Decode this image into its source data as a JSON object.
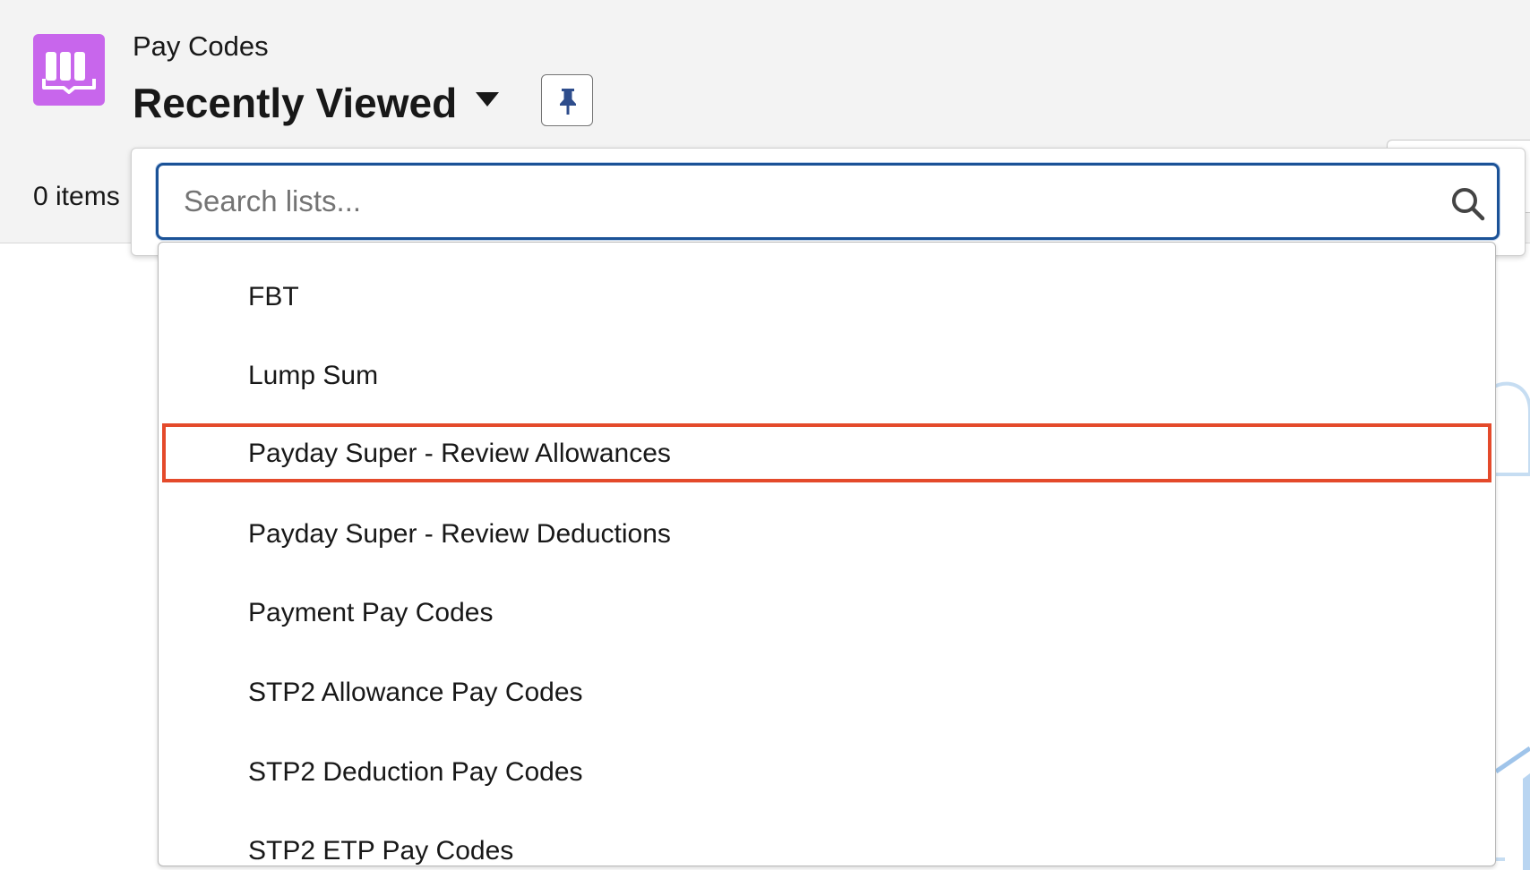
{
  "header": {
    "object_name": "Pay Codes",
    "list_view_title": "Recently Viewed",
    "items_count": "0 items",
    "app_icon": "book-icon",
    "caret_icon": "caret-down-icon",
    "pin_icon": "pin-icon"
  },
  "list_picker": {
    "search": {
      "placeholder": "Search lists...",
      "value": "",
      "icon": "search-icon"
    },
    "highlighted_option": "Payday Super - Review Allowances",
    "options": [
      {
        "label": "FBT"
      },
      {
        "label": "Lump Sum"
      },
      {
        "label": "Payday Super - Review Allowances"
      },
      {
        "label": "Payday Super - Review Deductions"
      },
      {
        "label": "Payment Pay Codes"
      },
      {
        "label": "STP2 Allowance Pay Codes"
      },
      {
        "label": "STP2 Deduction Pay Codes"
      },
      {
        "label": "STP2 ETP Pay Codes"
      }
    ]
  },
  "colors": {
    "app_icon_bg": "#c866ec",
    "focus_border": "#1b5297",
    "highlight_border": "#e44a2b",
    "pin_icon": "#2e4d8c"
  }
}
